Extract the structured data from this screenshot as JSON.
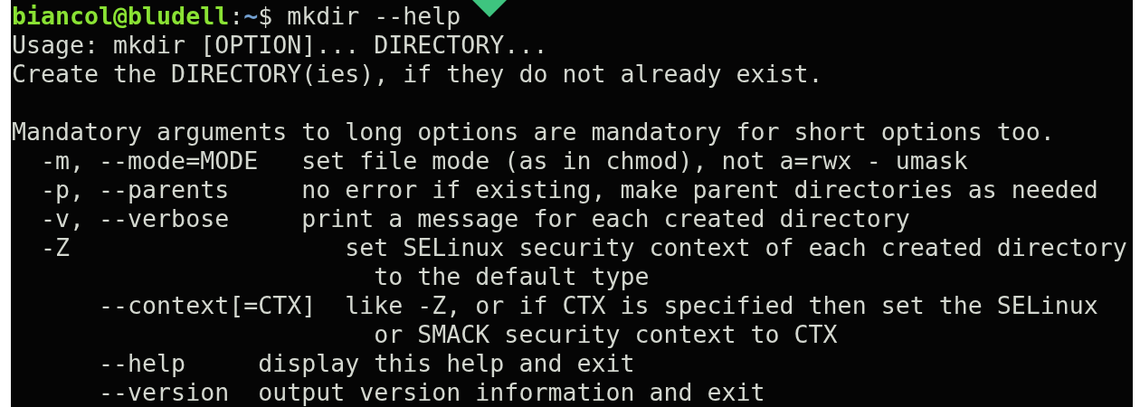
{
  "prompt": {
    "user_host": "biancol@bludell",
    "separator": ":",
    "path": "~",
    "symbol": "$",
    "command": "mkdir --help"
  },
  "output_blocks": [
    [
      "Usage: mkdir [OPTION]... DIRECTORY...",
      "Create the DIRECTORY(ies), if they do not already exist."
    ],
    [
      "Mandatory arguments to long options are mandatory for short options too.",
      "  -m, --mode=MODE   set file mode (as in chmod), not a=rwx - umask",
      "  -p, --parents     no error if existing, make parent directories as needed",
      "  -v, --verbose     print a message for each created directory",
      "  -Z                   set SELinux security context of each created directory",
      "                         to the default type",
      "      --context[=CTX]  like -Z, or if CTX is specified then set the SELinux",
      "                         or SMACK security context to CTX",
      "      --help     display this help and exit",
      "      --version  output version information and exit"
    ]
  ]
}
